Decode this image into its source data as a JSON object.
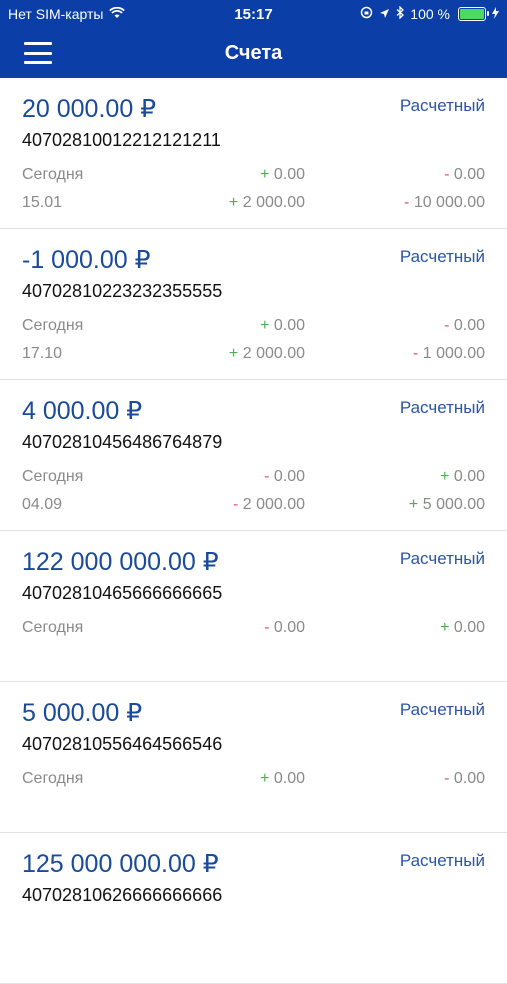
{
  "status": {
    "carrier": "Нет SIM-карты",
    "time": "15:17",
    "battery": "100 %"
  },
  "header": {
    "title": "Счета"
  },
  "accounts": [
    {
      "balance": "20 000.00 ₽",
      "type": "Расчетный",
      "number": "40702810012212121211",
      "today_label": "Сегодня",
      "today_in_sign": "+",
      "today_in": "0.00",
      "today_out_sign": "-",
      "today_out": "0.00",
      "date_label": "15.01",
      "date_in_sign": "+",
      "date_in": "2 000.00",
      "date_out_sign": "-",
      "date_out": "10 000.00"
    },
    {
      "balance": "-1 000.00 ₽",
      "type": "Расчетный",
      "number": "40702810223232355555",
      "today_label": "Сегодня",
      "today_in_sign": "+",
      "today_in": "0.00",
      "today_out_sign": "-",
      "today_out": "0.00",
      "date_label": "17.10",
      "date_in_sign": "+",
      "date_in": "2 000.00",
      "date_out_sign": "-",
      "date_out": "1 000.00"
    },
    {
      "balance": "4 000.00 ₽",
      "type": "Расчетный",
      "number": "40702810456486764879",
      "today_label": "Сегодня",
      "today_in_sign": "-",
      "today_in": "0.00",
      "today_out_sign": "+",
      "today_out": "0.00",
      "date_label": "04.09",
      "date_in_sign": "-",
      "date_in": "2 000.00",
      "date_out_sign": "+",
      "date_out": "5 000.00"
    },
    {
      "balance": "122 000 000.00 ₽",
      "type": "Расчетный",
      "number": "40702810465666666665",
      "today_label": "Сегодня",
      "today_in_sign": "-",
      "today_in": "0.00",
      "today_out_sign": "+",
      "today_out": "0.00"
    },
    {
      "balance": "5 000.00 ₽",
      "type": "Расчетный",
      "number": "40702810556464566546",
      "today_label": "Сегодня",
      "today_in_sign": "+",
      "today_in": "0.00",
      "today_out_sign": "-",
      "today_out": "0.00"
    },
    {
      "balance": "125 000 000.00 ₽",
      "type": "Расчетный",
      "number": "40702810626666666666"
    }
  ],
  "colors": {
    "header_bg": "#0b3ea6",
    "plus": "#4caf50",
    "minus": "#e0556a",
    "balance": "#1a4a9a"
  },
  "icons": [
    "wifi-icon",
    "menu-icon",
    "rotation-lock-icon",
    "location-icon",
    "bluetooth-icon",
    "battery-icon",
    "charging-icon"
  ]
}
